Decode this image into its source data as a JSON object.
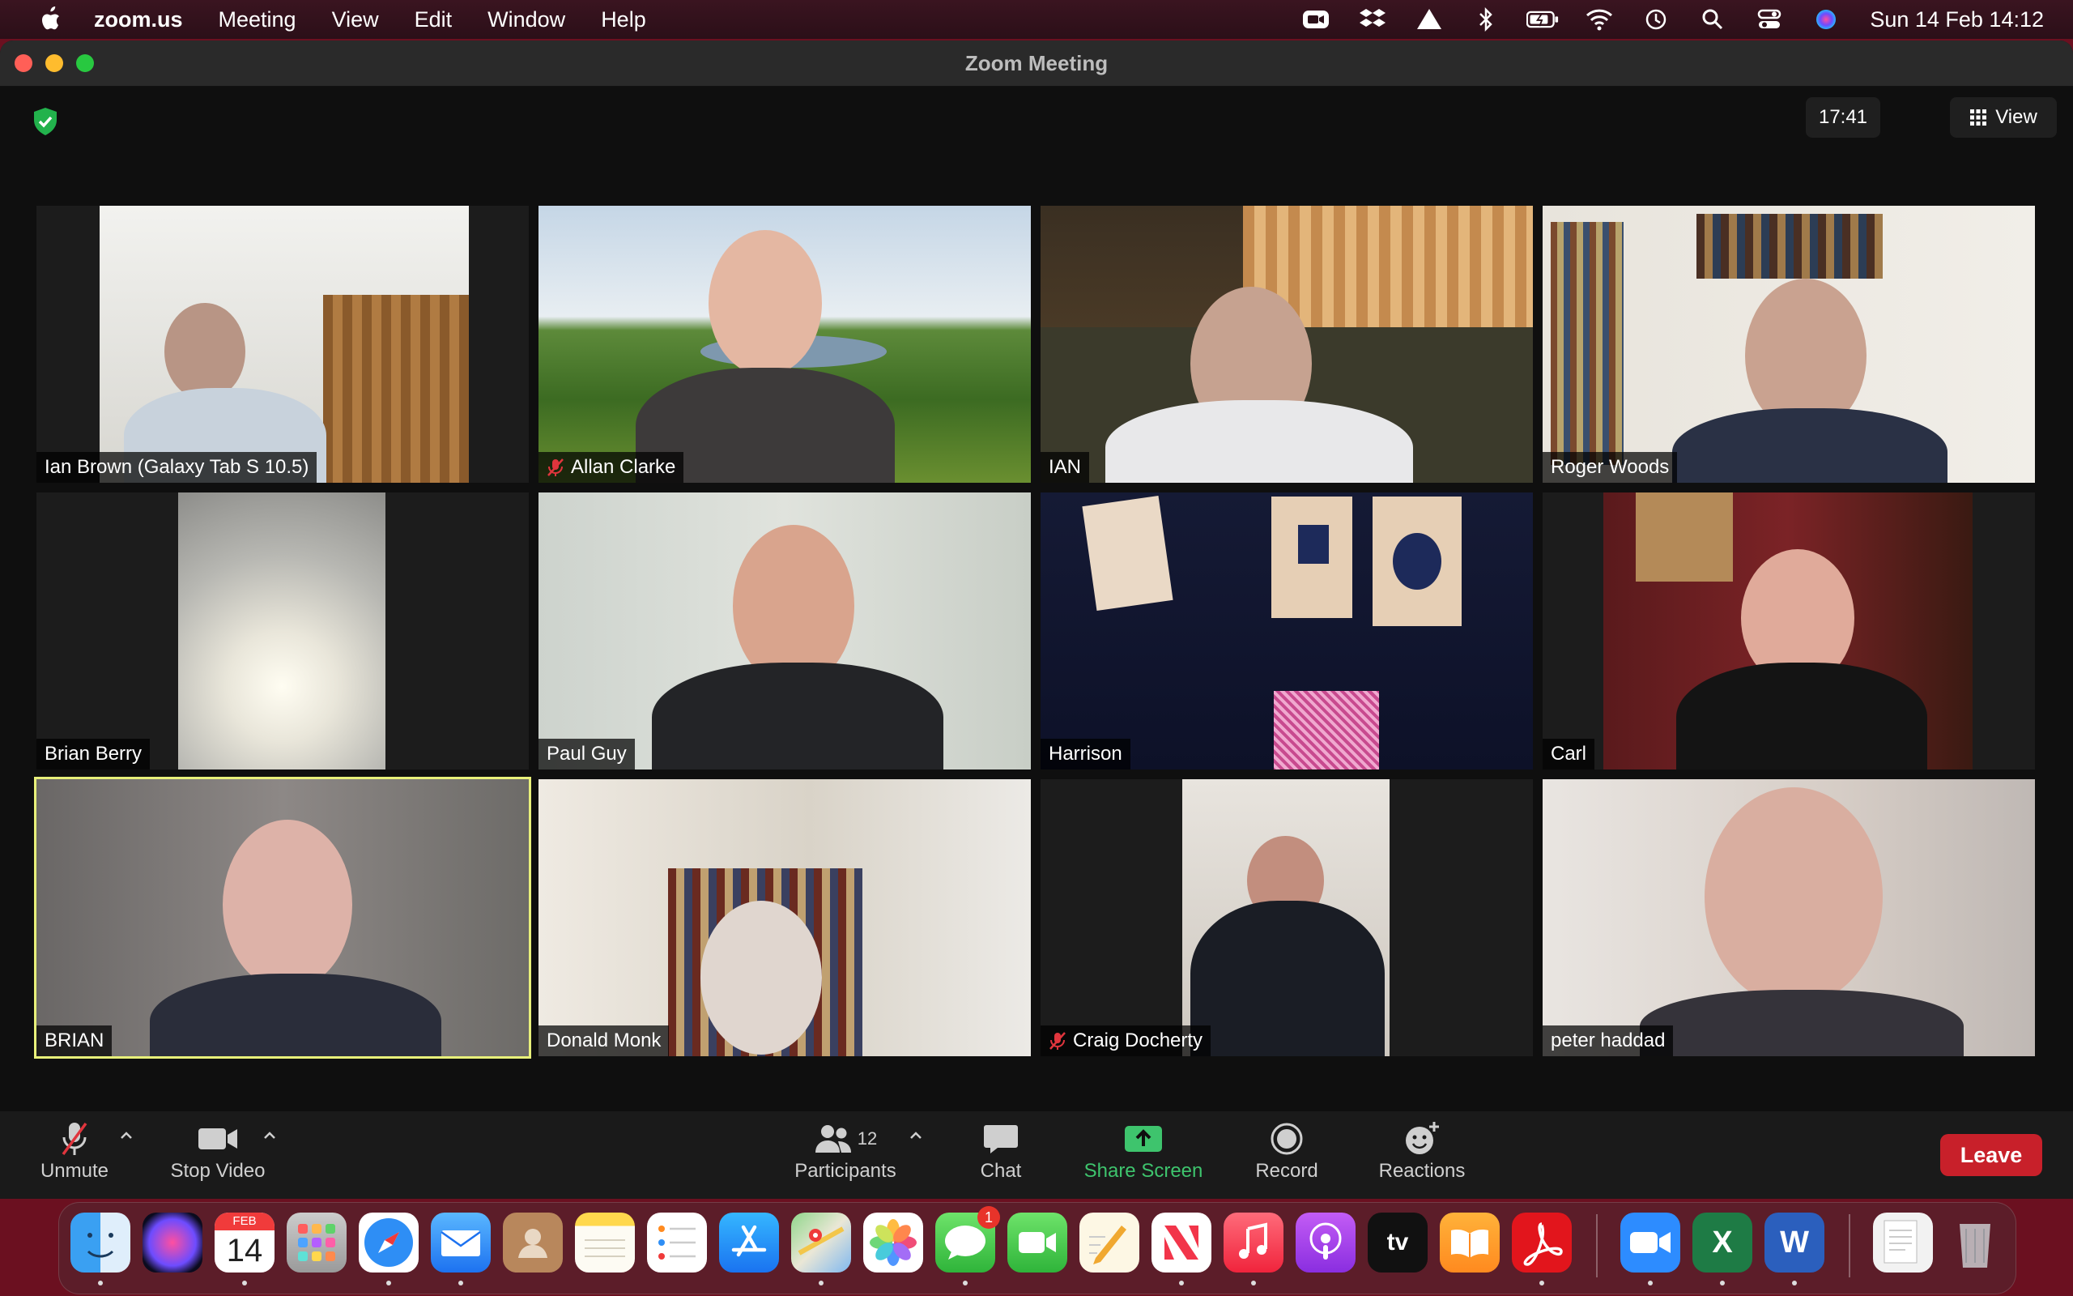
{
  "menubar": {
    "app_name": "zoom.us",
    "items": [
      "Meeting",
      "View",
      "Edit",
      "Window",
      "Help"
    ],
    "clock": "Sun 14 Feb  14:12",
    "status_icons": [
      "zoom-icon",
      "dropbox-icon",
      "drive-icon",
      "bluetooth-icon",
      "battery-icon",
      "wifi-icon",
      "time-machine-icon",
      "spotlight-icon",
      "control-center-icon",
      "siri-icon"
    ]
  },
  "window": {
    "title": "Zoom Meeting",
    "timer": "17:41",
    "view_label": "View"
  },
  "participants": [
    {
      "name": "Ian Brown (Galaxy Tab S 10.5)",
      "muted": false,
      "active": false
    },
    {
      "name": "Allan Clarke",
      "muted": true,
      "active": false
    },
    {
      "name": "IAN",
      "muted": false,
      "active": false
    },
    {
      "name": "Roger Woods",
      "muted": false,
      "active": false
    },
    {
      "name": "Brian Berry",
      "muted": false,
      "active": false
    },
    {
      "name": "Paul Guy",
      "muted": false,
      "active": false
    },
    {
      "name": "Harrison",
      "muted": false,
      "active": false
    },
    {
      "name": "Carl",
      "muted": false,
      "active": false
    },
    {
      "name": "BRIAN",
      "muted": false,
      "active": true
    },
    {
      "name": "Donald Monk",
      "muted": false,
      "active": false
    },
    {
      "name": "Craig Docherty",
      "muted": true,
      "active": false
    },
    {
      "name": "peter haddad",
      "muted": false,
      "active": false
    }
  ],
  "toolbar": {
    "unmute_label": "Unmute",
    "stop_video_label": "Stop Video",
    "participants_label": "Participants",
    "participants_count": "12",
    "chat_label": "Chat",
    "share_label": "Share Screen",
    "record_label": "Record",
    "reactions_label": "Reactions",
    "leave_label": "Leave"
  },
  "dock": {
    "calendar_month": "FEB",
    "calendar_day": "14",
    "messages_badge": "1",
    "tv_label": "tv",
    "excel_letter": "X",
    "word_letter": "W"
  },
  "colors": {
    "share_green": "#3ec46d",
    "leave_red": "#c8202a",
    "active_speaker": "#e8f07a"
  }
}
